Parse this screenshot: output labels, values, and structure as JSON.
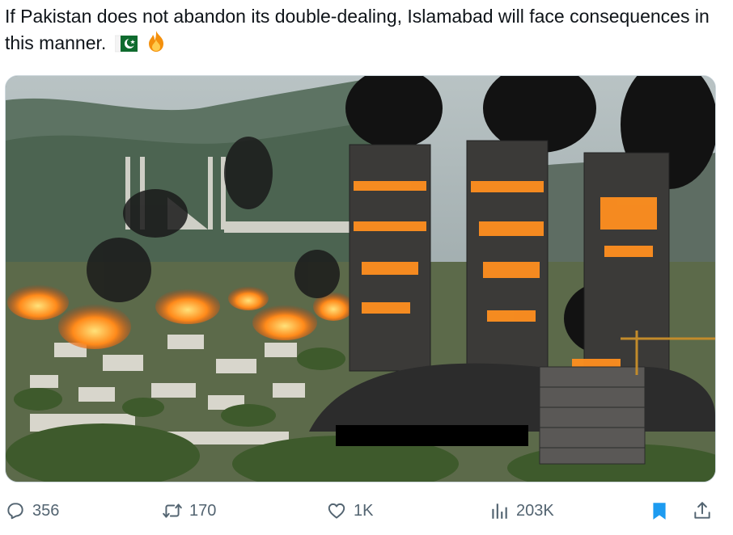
{
  "tweet": {
    "text": "If Pakistan does not abandon its double-dealing, Islamabad will face consequences in this manner.",
    "emojis": [
      "pakistan-flag-icon",
      "fire-icon"
    ]
  },
  "media": {
    "description_icon": "burning-skyscrapers-image",
    "censor_bar_color": "#000000"
  },
  "actions": {
    "replies": "356",
    "reposts": "170",
    "likes": "1K",
    "views": "203K"
  },
  "colors": {
    "text": "#0f1419",
    "muted": "#536471",
    "bookmark": "#1d9bf0",
    "border": "#cfd9de"
  }
}
